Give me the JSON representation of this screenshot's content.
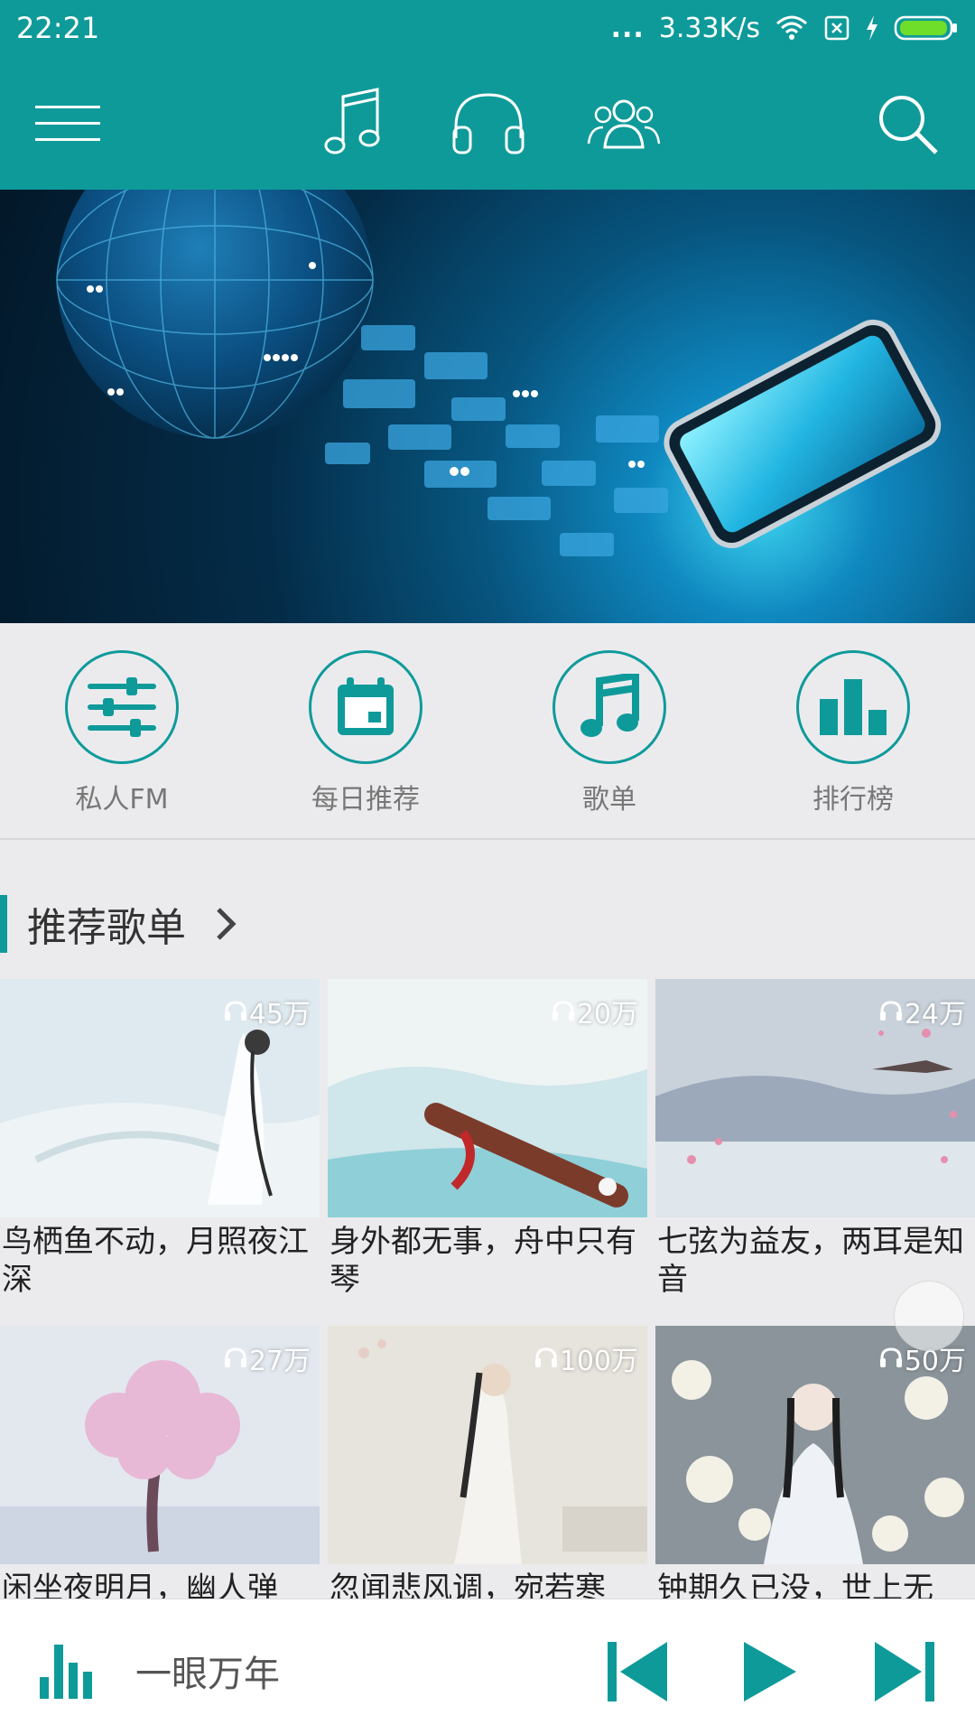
{
  "status_bar": {
    "time": "22:21",
    "dots": "...",
    "net_speed": "3.33K/s",
    "icons": [
      "wifi-icon",
      "sim-icon",
      "charging-icon",
      "battery-icon"
    ]
  },
  "nav": {
    "icons": [
      "menu-icon",
      "music-note-icon",
      "headphones-icon",
      "friends-icon",
      "search-icon"
    ]
  },
  "banner": {
    "image": "network-globe-smartphone"
  },
  "quick_entries": [
    {
      "label": "私人FM",
      "icon": "sliders-icon"
    },
    {
      "label": "每日推荐",
      "icon": "calendar-icon"
    },
    {
      "label": "歌单",
      "icon": "music-note-icon"
    },
    {
      "label": "排行榜",
      "icon": "bar-chart-icon"
    }
  ],
  "section": {
    "title": "推荐歌单"
  },
  "playlists": [
    {
      "title": "鸟栖鱼不动，月照夜江深",
      "plays": "45万"
    },
    {
      "title": "身外都无事，舟中只有琴",
      "plays": "20万"
    },
    {
      "title": "七弦为益友，两耳是知音",
      "plays": "24万"
    },
    {
      "title": "闲坐夜明月，幽人弹",
      "plays": "27万"
    },
    {
      "title": "忽闻悲风调，宛若寒",
      "plays": "100万"
    },
    {
      "title": "钟期久已没，世上无",
      "plays": "50万"
    }
  ],
  "player": {
    "song": "一眼万年",
    "icons": [
      "equalizer-icon",
      "previous-icon",
      "play-icon",
      "next-icon"
    ]
  },
  "colors": {
    "accent": "#0f9a9a",
    "background": "#ebebee"
  }
}
